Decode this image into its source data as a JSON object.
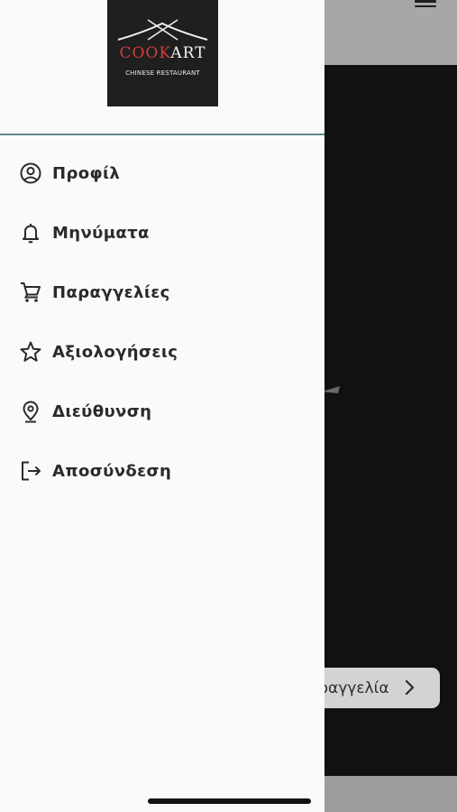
{
  "logo": {
    "word_part1": "COOK",
    "word_part2": "ART",
    "subtitle": "CHINESE RESTAURANT",
    "accent_color": "#d23b3b"
  },
  "background": {
    "order_button_label": "αραγγελία",
    "order_button_icon": "chevron-right-icon"
  },
  "drawer": {
    "divider_color": "#5e8791",
    "items": [
      {
        "label": "Προφίλ",
        "icon": "account-circle-icon"
      },
      {
        "label": "Μηνύματα",
        "icon": "bell-icon"
      },
      {
        "label": "Παραγγελίες",
        "icon": "cart-icon"
      },
      {
        "label": "Αξιολογήσεις",
        "icon": "star-icon"
      },
      {
        "label": "Διεύθυνση",
        "icon": "location-pin-icon"
      },
      {
        "label": "Αποσύνδεση",
        "icon": "logout-icon"
      }
    ]
  }
}
